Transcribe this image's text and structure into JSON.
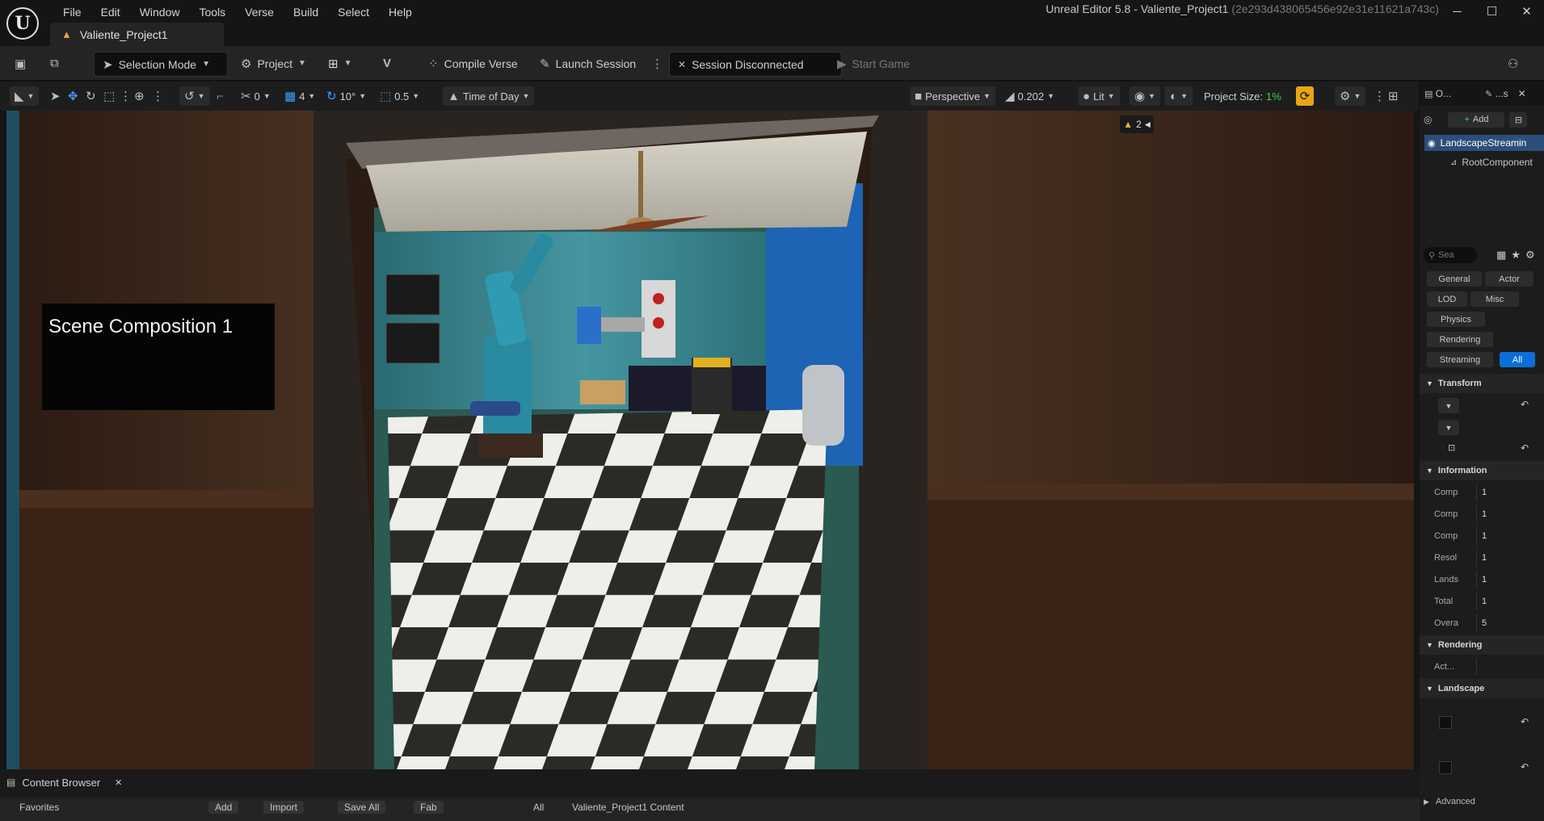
{
  "app": {
    "logo": "U",
    "menu": [
      "File",
      "Edit",
      "Window",
      "Tools",
      "Verse",
      "Build",
      "Select",
      "Help"
    ],
    "window_title": "Unreal Editor 5.8 - Valiente_Project1",
    "window_hash": "(2e293d438065456e92e31e11621a743c)",
    "window_buttons": {
      "minimize": "─",
      "maximize": "☐",
      "close": "✕"
    },
    "project_tab": "Valiente_Project1"
  },
  "toolbar": {
    "selection_mode": "Selection Mode",
    "project": "Project",
    "compile_verse": "Compile Verse",
    "launch_session": "Launch Session",
    "session_status": "Session Disconnected",
    "start_game": "Start Game"
  },
  "viewport_toolbar": {
    "snap_rotate_value": "0",
    "grid_value": "4",
    "angle_value": "10°",
    "scale_value": "0.5",
    "time_of_day": "Time of Day",
    "perspective": "Perspective",
    "camera_speed": "0.202",
    "lit": "Lit",
    "project_size_label": "Project Size:",
    "project_size_value": "1%"
  },
  "viewport": {
    "warning_count": "2",
    "scene_sign": "Scene Composition 1"
  },
  "content_browser": {
    "tab_label": "Content Browser",
    "close": "✕",
    "favorites": "Favorites",
    "add": "Add",
    "import": "Import",
    "save_all": "Save All",
    "fab": "Fab",
    "path_all": "All",
    "path_content": "Valiente_Project1 Content"
  },
  "details": {
    "outliner_tab": "O...",
    "details_tab": "...s",
    "add_button": "Add",
    "actor_name": "LandscapeStreamin",
    "root_component": "RootComponent",
    "search_placeholder": "Sea",
    "filters": [
      "General",
      "Actor",
      "LOD",
      "Misc",
      "Physics",
      "Rendering",
      "Streaming",
      "All"
    ],
    "sections": {
      "transform": "Transform",
      "information": "Information",
      "rendering": "Rendering",
      "landscape": "Landscape",
      "advanced": "Advanced"
    },
    "information_rows": [
      {
        "key": "Comp",
        "value": "1"
      },
      {
        "key": "Comp",
        "value": "1"
      },
      {
        "key": "Comp",
        "value": "1"
      },
      {
        "key": "Resol",
        "value": "1"
      },
      {
        "key": "Lands",
        "value": "1"
      },
      {
        "key": "Total",
        "value": "1"
      },
      {
        "key": "Overa",
        "value": "5"
      }
    ],
    "rendering_row": "Act..."
  },
  "colors": {
    "accent": "#0a6fd8",
    "warning": "#e8a23a",
    "project_size": "#3fcf4f"
  }
}
